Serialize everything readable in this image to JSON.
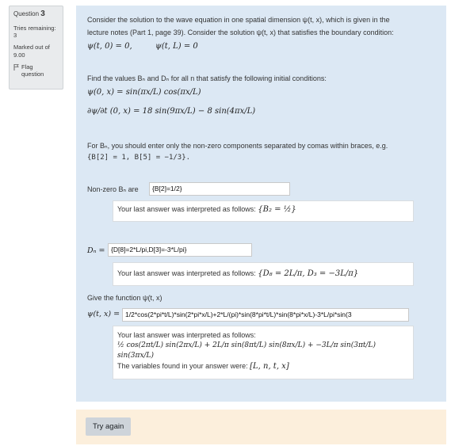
{
  "info": {
    "question_label": "Question",
    "question_number": "3",
    "tries_remaining_label": "Tries remaining:",
    "tries_remaining_value": "3",
    "marked_out_of_label": "Marked out of",
    "marked_out_of_value": "9.00",
    "flag_label": "Flag",
    "flag_label2": "question"
  },
  "question": {
    "intro_line1": "Consider the solution to the wave equation in one spatial dimension ψ(t, x), which is given in the",
    "intro_line2": "lecture notes (Part 1, page 39). Consider the solution ψ(t, x) that satisfies the boundary condition:",
    "bc1": "ψ(t, 0) = 0,",
    "bc2": "ψ(t, L) = 0",
    "find_text": "Find the values Bₙ and Dₙ for all n that satisfy the following initial conditions:",
    "ic1": "ψ(0, x) = sin(πx/L) cos(πx/L)",
    "ic2": "∂ψ/∂t (0, x) = 18 sin(9πx/L) − 8 sin(4πx/L)",
    "instruction_line1": "For Bₙ, you should enter only the non-zero components separated by comas within braces, e.g.",
    "instruction_example": "{B[2] = 1, B[5] = −1/3}."
  },
  "bn": {
    "label": "Non-zero Bₙ are",
    "value": "{B[2]=1/2}",
    "feedback_prefix": "Your last answer was interpreted as follows:",
    "feedback_math": "{B₂ = ½}"
  },
  "dn": {
    "label": "Dₙ =",
    "value": "{D[8]=2*L/pi,D[3]=-3*L/pi}",
    "feedback_prefix": "Your last answer was interpreted as follows:",
    "feedback_math": "{D₈ = 2L/π, D₃ = −3L/π}"
  },
  "psi": {
    "prompt": "Give the function ψ(t, x)",
    "label": "ψ(t, x) =",
    "value": "1/2*cos(2*pi*t/L)*sin(2*pi*x/L)+2*L/(pi)*sin(8*pi*t/L)*sin(8*pi*x/L)-3*L/pi*sin(3",
    "feedback_prefix": "Your last answer was interpreted as follows:",
    "feedback_math": "½ cos(2πt/L) sin(2πx/L) + 2L/π sin(8πt/L) sin(8πx/L) + −3L/π sin(3πt/L) sin(3πx/L)",
    "variables_text": "The variables found in your answer were:",
    "variables_math": "[L, n, t, x]"
  },
  "buttons": {
    "try_again": "Try again"
  }
}
